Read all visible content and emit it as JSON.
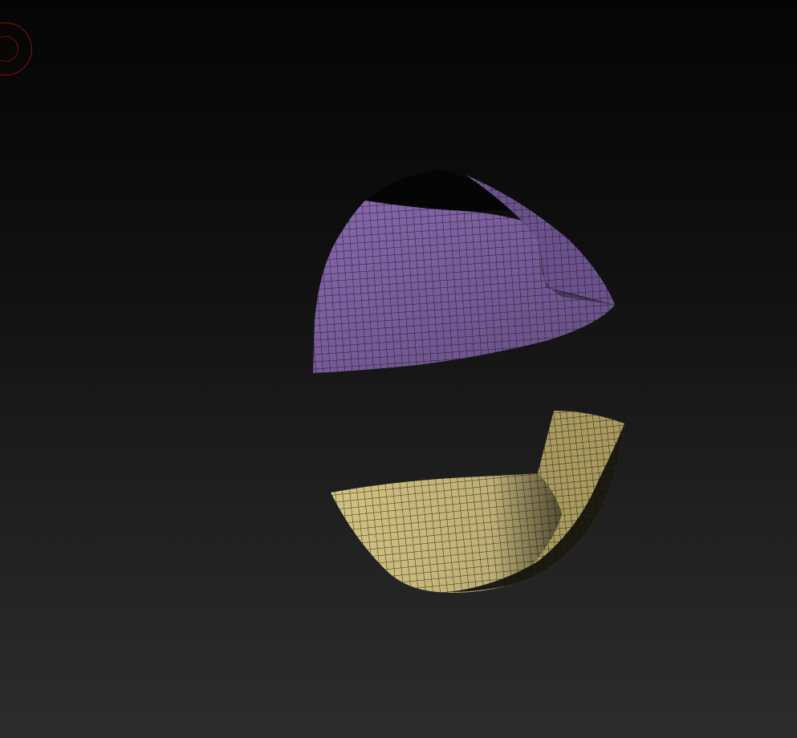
{
  "viewport": {
    "background_top": "#050505",
    "background_bottom": "#2c2c2c"
  },
  "brush_cursor": {
    "color": "#8a0f0f",
    "icon": "brush-circle-icon"
  },
  "mesh": {
    "upper_shell_color": "#8a6ab0",
    "lower_shell_color": "#cfc080",
    "wire_color": "#1e1a24"
  }
}
